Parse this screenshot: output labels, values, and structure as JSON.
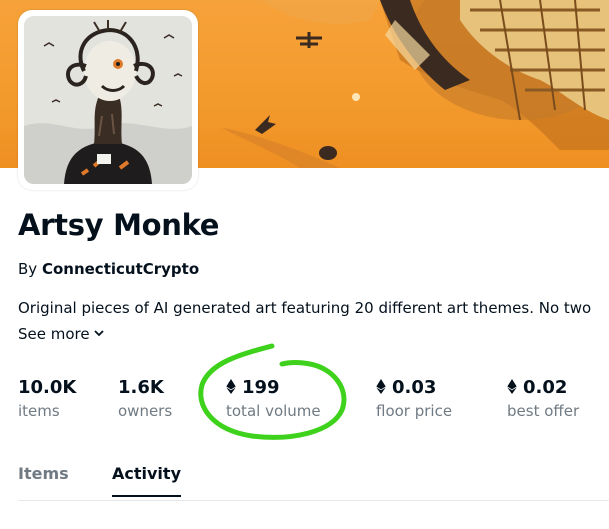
{
  "collection": {
    "name": "Artsy Monke",
    "by_prefix": "By",
    "creator": "ConnecticutCrypto",
    "description": "Original pieces of AI generated art featuring 20 different art themes. No two",
    "see_more": "See more"
  },
  "stats": [
    {
      "value": "10.0K",
      "label": "items",
      "eth": false
    },
    {
      "value": "1.6K",
      "label": "owners",
      "eth": false
    },
    {
      "value": "199",
      "label": "total volume",
      "eth": true
    },
    {
      "value": "0.03",
      "label": "floor price",
      "eth": true
    },
    {
      "value": "0.02",
      "label": "best offer",
      "eth": true
    }
  ],
  "tabs": [
    {
      "label": "Items",
      "active": false
    },
    {
      "label": "Activity",
      "active": true
    }
  ],
  "annotation": {
    "color": "#3fd21c",
    "target": "total volume"
  },
  "icons": {
    "eth": "ethereum-icon",
    "chevron": "chevron-down-icon"
  },
  "colors": {
    "banner": "#f39a2c",
    "text": "#04111d",
    "muted": "#707a83"
  }
}
